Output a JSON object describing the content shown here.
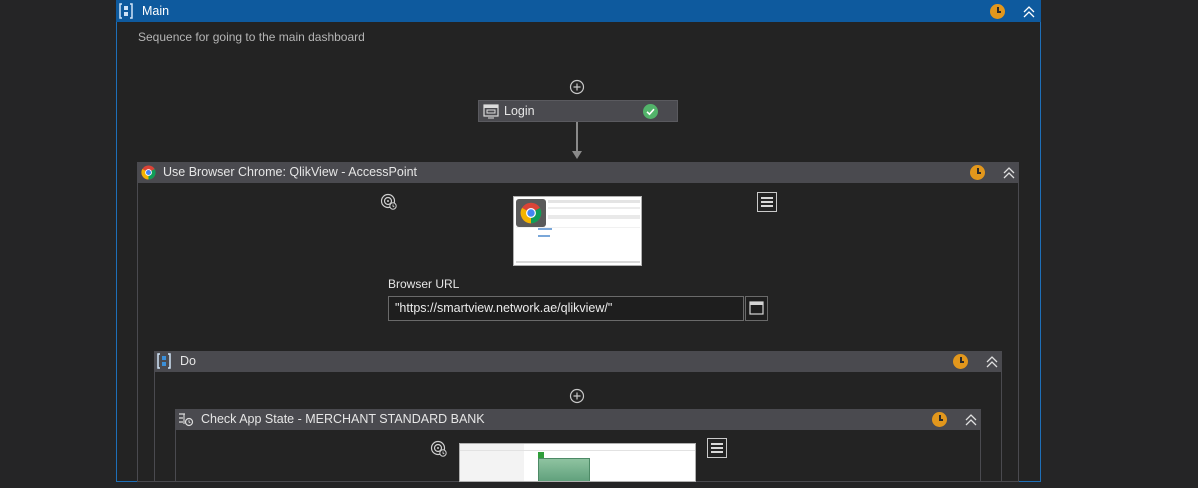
{
  "main": {
    "title": "Main",
    "annotation": "Sequence for going to the main dashboard"
  },
  "login": {
    "label": "Login",
    "status": "success"
  },
  "browser_scope": {
    "title": "Use Browser Chrome: QlikView - AccessPoint",
    "url_label": "Browser URL",
    "url_value": "\"https://smartview.network.ae/qlikview/\""
  },
  "do_block": {
    "title": "Do"
  },
  "check_app_state": {
    "title": "Check App State - MERCHANT STANDARD BANK"
  },
  "colors": {
    "main_header": "#0e5a9e",
    "activity_header": "#4a4a4f",
    "canvas": "#252526",
    "timer_badge": "#e2971c",
    "success_badge": "#52b36a"
  }
}
